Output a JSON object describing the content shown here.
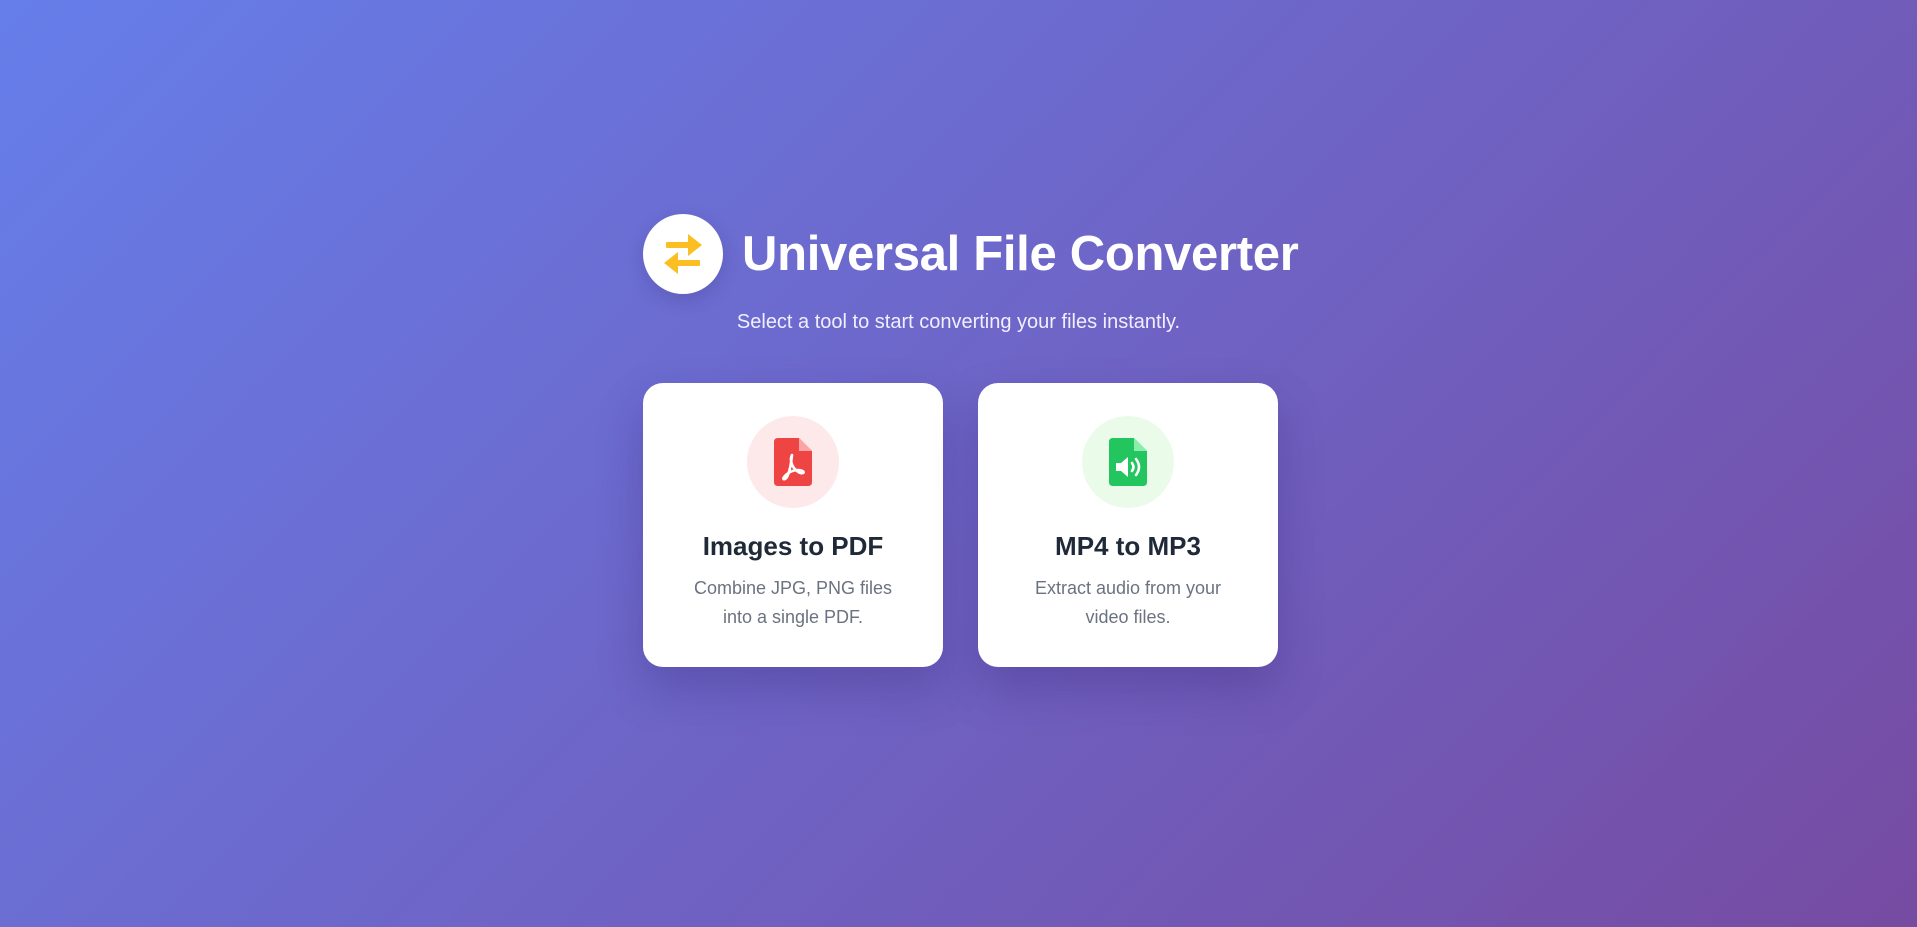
{
  "header": {
    "logo_icon": "swap-arrows-icon",
    "title": "Universal File Converter",
    "subtitle": "Select a tool to start converting your files instantly."
  },
  "tools": [
    {
      "icon": "file-pdf-icon",
      "title": "Images to PDF",
      "description": "Combine JPG, PNG files into a single PDF.",
      "accent": "#ef4444",
      "icon_bg": "#fee9ea"
    },
    {
      "icon": "file-audio-icon",
      "title": "MP4 to MP3",
      "description": "Extract audio from your video files.",
      "accent": "#22c55e",
      "icon_bg": "#eafbea"
    }
  ],
  "colors": {
    "gradient_start": "#667eea",
    "gradient_end": "#764ba2",
    "logo_icon": "#fbbf24"
  }
}
